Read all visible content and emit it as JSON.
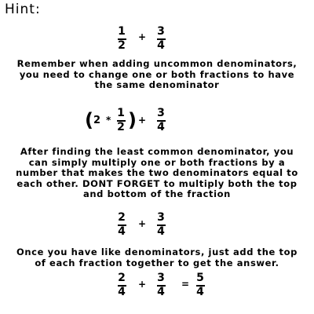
{
  "hint": {
    "title": "Hint:"
  },
  "step1": {
    "fraction_a": {
      "num": "1",
      "den": "2"
    },
    "operator": "+",
    "fraction_b": {
      "num": "3",
      "den": "4"
    }
  },
  "explanation1": [
    "Remember when adding uncommon denominators,",
    "you need to change one or both fractions to have",
    "the same denominator"
  ],
  "step2": {
    "open_paren": "(",
    "multiplier": "2",
    "times": "*",
    "fraction_a": {
      "num": "1",
      "den": "2"
    },
    "close_paren": ")",
    "operator": "+",
    "fraction_b": {
      "num": "3",
      "den": "4"
    }
  },
  "explanation2": [
    "After finding the least common denominator, you",
    "can simply multiply one or both fractions by a",
    "number that makes the two denominators equal to",
    "each other. DONT FORGET to multiply both the top",
    "and bottom of the fraction"
  ],
  "step3": {
    "fraction_a": {
      "num": "2",
      "den": "4"
    },
    "operator": "+",
    "fraction_b": {
      "num": "3",
      "den": "4"
    }
  },
  "explanation3": [
    "Once you have like denominators, just add the top",
    "of each fraction together to get the answer."
  ],
  "step4": {
    "fraction_a": {
      "num": "2",
      "den": "4"
    },
    "operator": "+",
    "fraction_b": {
      "num": "3",
      "den": "4"
    },
    "equals": "=",
    "result": {
      "num": "5",
      "den": "4"
    }
  }
}
